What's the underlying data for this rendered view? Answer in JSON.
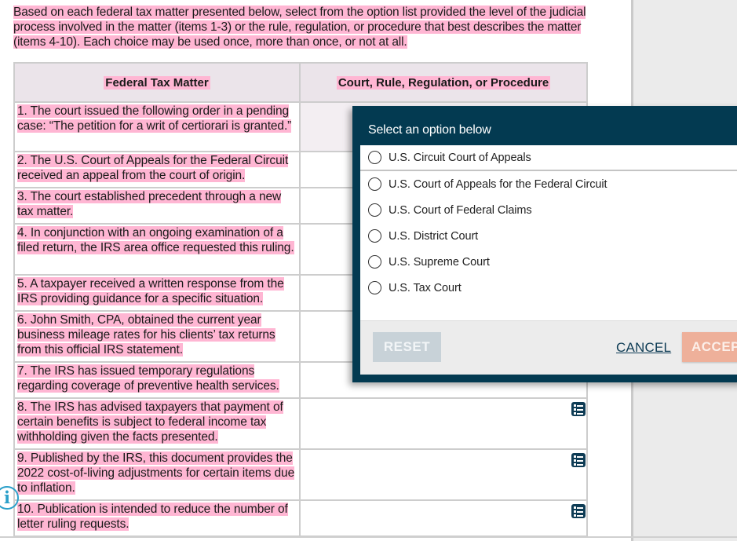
{
  "instructions": "Based on each federal tax matter presented below, select from the option list provided the level of the judicial process involved in the matter (items 1-3) or the rule, regulation, or procedure that best describes the matter (items 4-10). Each choice may be used once, more than once, or not at all.",
  "table": {
    "headers": [
      "Federal Tax Matter",
      "Court, Rule, Regulation, or Procedure"
    ],
    "rows": [
      {
        "matter": "1. The court issued the following order in a pending case: “The petition for a writ of certiorari is granted.”",
        "answer": ""
      },
      {
        "matter": "2. The U.S. Court of Appeals for the Federal Circuit received an appeal from the court of origin.",
        "answer": ""
      },
      {
        "matter": "3. The court established precedent through a new tax matter.",
        "answer": ""
      },
      {
        "matter": "4. In conjunction with an ongoing examination of a filed return, the IRS area office requested this ruling.",
        "answer": ""
      },
      {
        "matter": "5. A taxpayer received a written response from the IRS providing guidance for a specific situation.",
        "answer": ""
      },
      {
        "matter": "6. John Smith, CPA, obtained the current year business mileage rates for his clients’ tax returns from this official IRS statement.",
        "answer": ""
      },
      {
        "matter": "7. The IRS has issued temporary regulations regarding coverage of preventive health services.",
        "answer": ""
      },
      {
        "matter": "8. The IRS has advised taxpayers that payment of certain benefits is subject to federal income tax withholding given the facts presented.",
        "answer": ""
      },
      {
        "matter": "9. Published by the IRS, this document provides the 2022 cost-of-living adjustments for certain items due to inflation.",
        "answer": ""
      },
      {
        "matter": "10. Publication is intended to reduce the number of letter ruling requests.",
        "answer": ""
      }
    ]
  },
  "modal": {
    "title": "Select an option below",
    "options": [
      "U.S. Circuit Court of Appeals",
      "U.S. Court of Appeals for the Federal Circuit",
      "U.S. Court of Federal Claims",
      "U.S. District Court",
      "U.S. Supreme Court",
      "U.S. Tax Court"
    ],
    "reset_label": "RESET",
    "cancel_label": "CANCEL",
    "accept_label": "ACCEPT"
  },
  "icons": {
    "row_selector": "list-icon",
    "info": "info-icon",
    "info_glyph": "i"
  },
  "colors": {
    "highlight": "#ffb6d3",
    "modal_bg": "#033a51",
    "accept": "#eeb09a",
    "reset": "#c8d2d8",
    "info": "#2a9fc9"
  }
}
